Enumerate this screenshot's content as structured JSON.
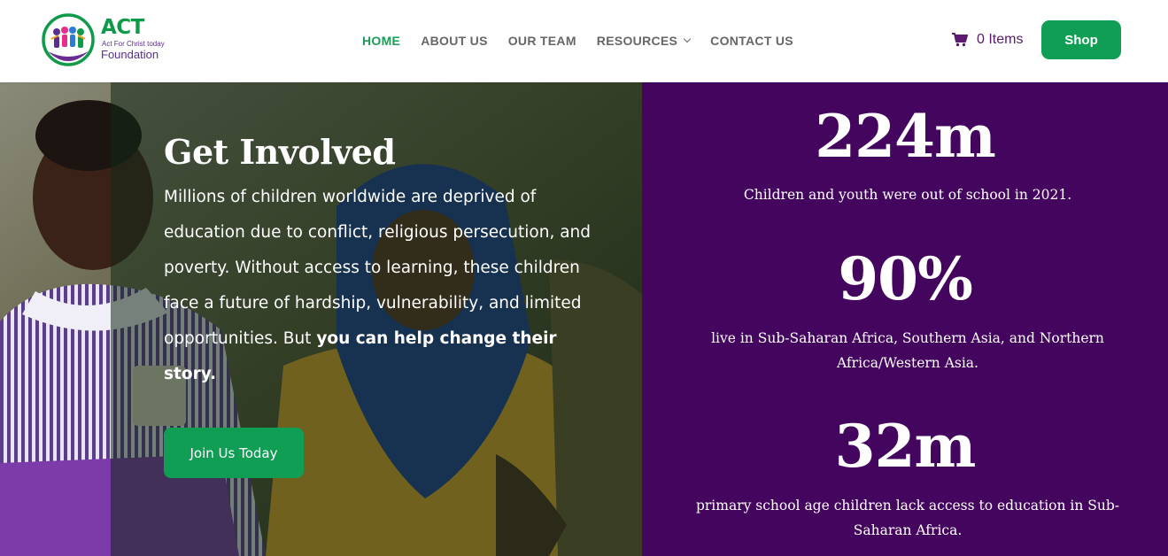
{
  "logo": {
    "act": "ACT",
    "tagline": "Act For Christ today",
    "foundation": "Foundation"
  },
  "nav": {
    "home": "HOME",
    "about": "ABOUT US",
    "team": "OUR TEAM",
    "resources": "RESOURCES",
    "contact": "CONTACT US"
  },
  "cart": {
    "label": "0 Items"
  },
  "shop": {
    "label": "Shop"
  },
  "hero": {
    "title": "Get Involved",
    "body": "Millions of children worldwide are deprived of education due to conflict, religious persecution, and poverty. Without access to learning, these children face a future of hardship, vulnerability, and limited opportunities. But ",
    "body_bold": "you can help change their story.",
    "button": "Join Us Today"
  },
  "stats": [
    {
      "value": "224m",
      "text": "Children and youth were out of school in 2021."
    },
    {
      "value": "90%",
      "text": "live in Sub-Saharan Africa, Southern Asia, and Northern Africa/Western Asia."
    },
    {
      "value": "32m",
      "text": "primary school age children lack access to education in Sub-Saharan Africa."
    }
  ],
  "colors": {
    "brand_green": "#0f9e54",
    "brand_purple": "#44055f",
    "nav_active": "#1a9b57"
  }
}
